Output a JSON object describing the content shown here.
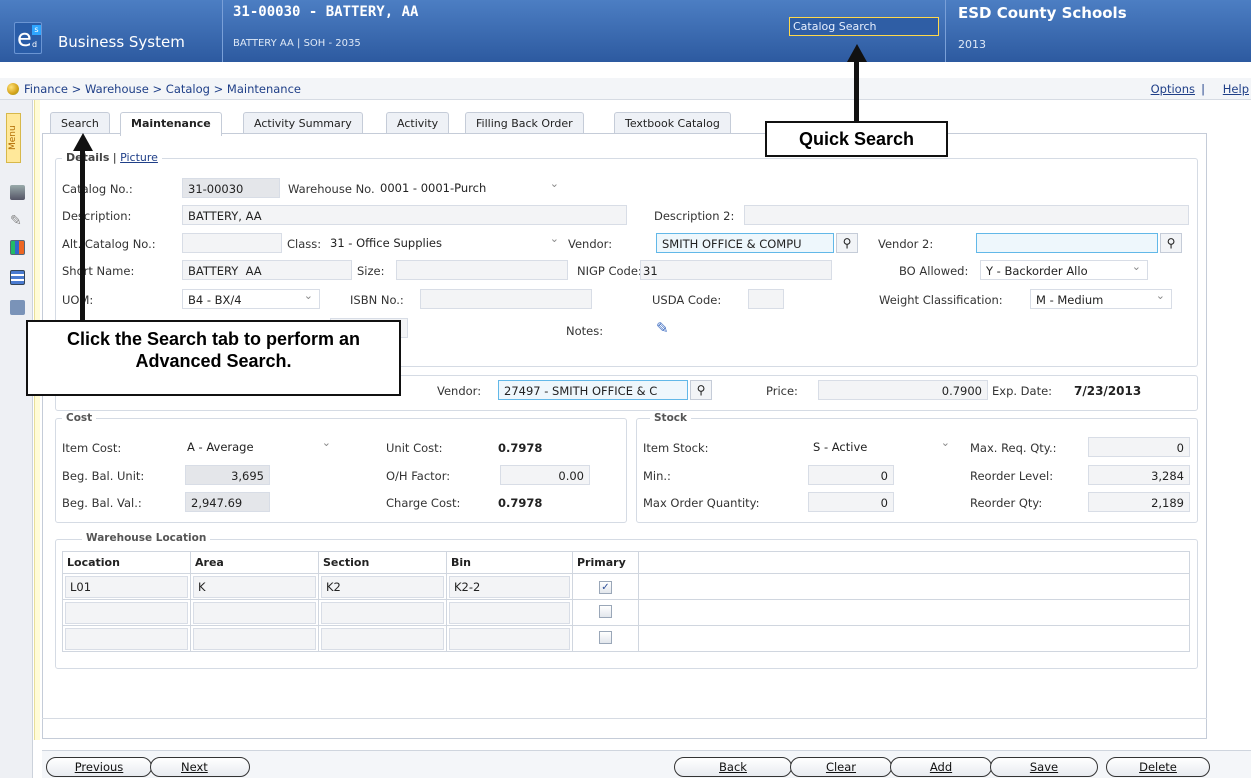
{
  "header": {
    "app_name": "Business System",
    "record_title": "31-00030 - BATTERY, AA",
    "record_subtitle": "BATTERY AA | SOH - 2035",
    "quick_search_placeholder": "Catalog Search",
    "org_name": "ESD County Schools",
    "year": "2013"
  },
  "breadcrumb": "Finance > Warehouse > Catalog > Maintenance",
  "top_links": {
    "options": "Options",
    "sep": "|",
    "help": "Help"
  },
  "side_menu_label": "Menu",
  "tabs": [
    "Search",
    "Maintenance",
    "Activity Summary",
    "Activity",
    "Filling Back Order",
    "Textbook Catalog"
  ],
  "subtabs": {
    "details": "Details",
    "sep": "|",
    "picture": "Picture"
  },
  "details": {
    "catalog_no_label": "Catalog No.:",
    "catalog_no": "31-00030",
    "warehouse_no_label": "Warehouse No.:",
    "warehouse_no": "0001 - 0001-Purch",
    "description_label": "Description:",
    "description": "BATTERY, AA",
    "description2_label": "Description 2:",
    "description2": "",
    "alt_catalog_label": "Alt. Catalog No.:",
    "alt_catalog": "",
    "class_label": "Class:",
    "class_value": "31 - Office Supplies",
    "vendor_label": "Vendor:",
    "vendor": "SMITH OFFICE & COMPU",
    "vendor2_label": "Vendor 2:",
    "vendor2": "",
    "short_name_label": "Short Name:",
    "short_name": "BATTERY  AA",
    "size_label": "Size:",
    "size": "",
    "nigp_label": "NIGP Code:",
    "nigp": "31",
    "bo_allowed_label": "BO Allowed:",
    "bo_allowed": "Y - Backorder Allo",
    "uom_label": "UOM:",
    "uom": "B4 - BX/4",
    "isbn_label": "ISBN No.:",
    "isbn": "",
    "usda_label": "USDA Code:",
    "usda": "",
    "weight_label": "Weight Classification:",
    "weight": "M - Medium",
    "notes_label": "Notes:"
  },
  "pricing": {
    "vendor_label": "Vendor:",
    "vendor": "27497 - SMITH OFFICE & C",
    "price_label": "Price:",
    "price": "0.7900",
    "exp_label": "Exp. Date:",
    "exp_date": "7/23/2013"
  },
  "cost": {
    "title": "Cost",
    "item_cost_label": "Item Cost:",
    "item_cost": "A - Average",
    "unit_cost_label": "Unit Cost:",
    "unit_cost": "0.7978",
    "beg_unit_label": "Beg. Bal. Unit:",
    "beg_unit": "3,695",
    "oh_factor_label": "O/H Factor:",
    "oh_factor": "0.00",
    "beg_val_label": "Beg. Bal. Val.:",
    "beg_val": "2,947.69",
    "charge_label": "Charge Cost:",
    "charge_cost": "0.7978"
  },
  "stock": {
    "title": "Stock",
    "item_stock_label": "Item Stock:",
    "item_stock": "S - Active",
    "max_req_label": "Max. Req. Qty.:",
    "max_req": "0",
    "min_label": "Min.:",
    "min": "0",
    "reorder_level_label": "Reorder Level:",
    "reorder_level": "3,284",
    "max_order_label": "Max Order Quantity:",
    "max_order": "0",
    "reorder_qty_label": "Reorder Qty:",
    "reorder_qty": "2,189"
  },
  "warehouse_location": {
    "title": "Warehouse Location",
    "columns": [
      "Location",
      "Area",
      "Section",
      "Bin",
      "Primary"
    ],
    "rows": [
      {
        "location": "L01",
        "area": "K",
        "section": "K2",
        "bin": "K2-2",
        "primary": "✓"
      },
      {
        "location": "",
        "area": "",
        "section": "",
        "bin": "",
        "primary": ""
      },
      {
        "location": "",
        "area": "",
        "section": "",
        "bin": "",
        "primary": ""
      }
    ]
  },
  "callouts": {
    "quick_search": "Quick Search",
    "search_tab": "Click the Search tab to perform an Advanced Search."
  },
  "buttons": {
    "previous": "Previous",
    "next": "Next",
    "back": "Back",
    "clear": "Clear",
    "add": "Add",
    "save": "Save",
    "delete": "Delete"
  }
}
